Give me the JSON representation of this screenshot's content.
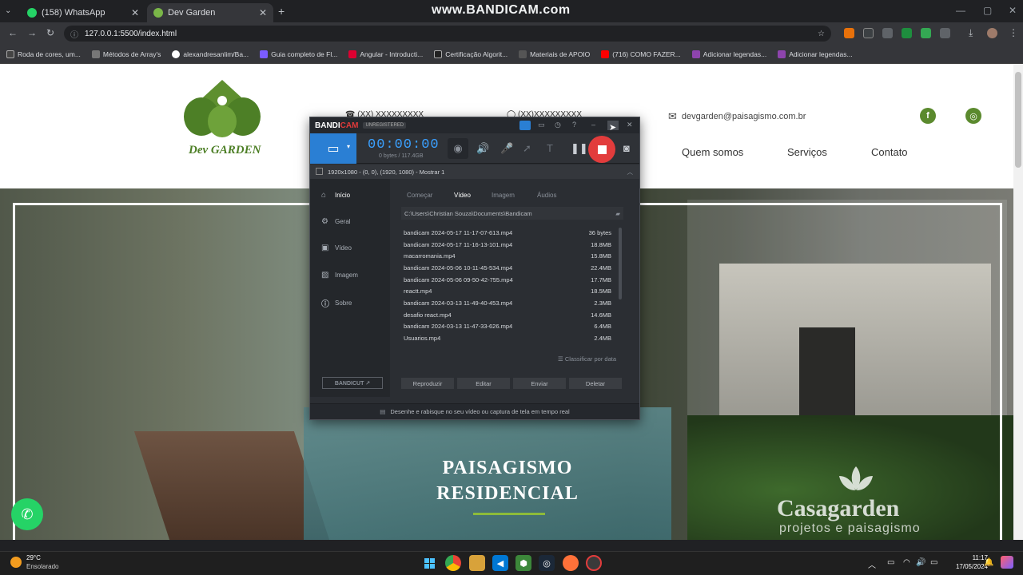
{
  "browser": {
    "tabs": [
      {
        "title": "(158) WhatsApp",
        "close": "✕"
      },
      {
        "title": "Dev Garden",
        "close": "✕"
      }
    ],
    "new_tab": "+",
    "watermark": "www.BANDICAM.com",
    "url": "127.0.0.1:5500/index.html",
    "bookmarks": [
      "Roda de cores, um...",
      "Métodos de Array's",
      "alexandresanlim/Ba...",
      "Guia completo de Fl...",
      "Angular - Introducti...",
      "Certificação Algorit...",
      "Materiais de APOIO",
      "(716) COMO FAZER...",
      "Adicionar legendas...",
      "Adicionar legendas..."
    ]
  },
  "site": {
    "logo_text": "Dev GARDEN",
    "phone1": "(XX) XXXXXXXXX",
    "phone2": "(XX)XXXXXXXXX",
    "email": "devgarden@paisagismo.com.br",
    "nav": [
      "Quem somos",
      "Serviços",
      "Contato"
    ],
    "hero_line1": "PAISAGISMO",
    "hero_line2": "RESIDENCIAL",
    "brand": "Casagarden",
    "brand_sub": "projetos e paisagismo"
  },
  "bandicam": {
    "logo": "BANDI",
    "logo_accent": "CAM",
    "unregistered": "UNREGISTERED",
    "timer": "00:00:00",
    "bytes": "0 bytes / 117.4GB",
    "area": "1920x1080 - (0, 0), (1920, 1080) - Mostrar 1",
    "sidebar": [
      "Início",
      "Geral",
      "Vídeo",
      "Imagem",
      "Sobre"
    ],
    "tabs": [
      "Começar",
      "Vídeo",
      "Imagem",
      "Áudios"
    ],
    "path": "C:\\Users\\Christian Souza\\Documents\\Bandicam",
    "files": [
      {
        "name": "bandicam 2024-05-17 11-17-07-613.mp4",
        "size": "36 bytes"
      },
      {
        "name": "bandicam 2024-05-17 11-16-13-101.mp4",
        "size": "18.8MB"
      },
      {
        "name": "macarromania.mp4",
        "size": "15.8MB"
      },
      {
        "name": "bandicam 2024-05-06 10-11-45-534.mp4",
        "size": "22.4MB"
      },
      {
        "name": "bandicam 2024-05-06 09-50-42-755.mp4",
        "size": "17.7MB"
      },
      {
        "name": "reactt.mp4",
        "size": "18.5MB"
      },
      {
        "name": "bandicam 2024-03-13 11-49-40-453.mp4",
        "size": "2.3MB"
      },
      {
        "name": "desafio react.mp4",
        "size": "14.6MB"
      },
      {
        "name": "bandicam 2024-03-13 11-47-33-626.mp4",
        "size": "6.4MB"
      },
      {
        "name": "Usuarios.mp4",
        "size": "2.4MB"
      }
    ],
    "sort": "Classificar por data",
    "actions": [
      "Reproduzir",
      "Editar",
      "Enviar",
      "Deletar"
    ],
    "bandicut": "BANDICUT ↗",
    "footer": "Desenhe e rabisque no seu vídeo ou captura de tela em tempo real"
  },
  "taskbar": {
    "weather_temp": "29°C",
    "weather_desc": "Ensolarado",
    "time": "11:17",
    "date": "17/05/2024"
  }
}
